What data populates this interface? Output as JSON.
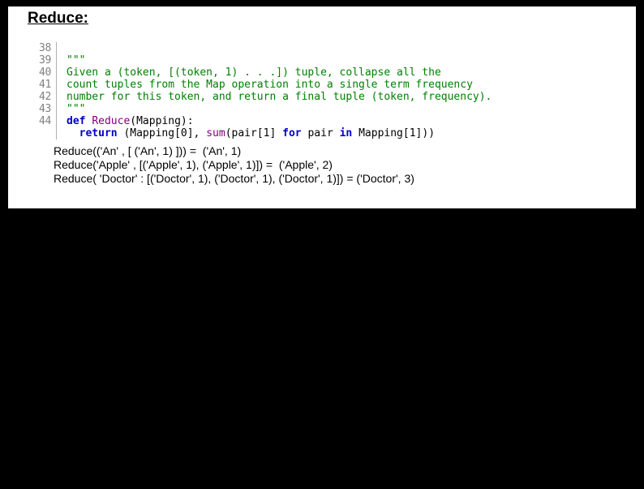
{
  "title": "Reduce:",
  "code": {
    "line_numbers": [
      "38",
      "39",
      "40",
      "41",
      "42",
      "43",
      "44"
    ],
    "l38": "\"\"\"",
    "l39": "Given a (token, [(token, 1) . . .]) tuple, collapse all the",
    "l40": "count tuples from the Map operation into a single term frequency",
    "l41": "number for this token, and return a final tuple (token, frequency).",
    "l42": "\"\"\"",
    "l43": {
      "def": "def ",
      "name": "Reduce",
      "rest": "(Mapping):"
    },
    "l44": {
      "indent": "  ",
      "ret": "return ",
      "p1": "(Mapping[",
      "n0": "0",
      "p2": "], ",
      "sum": "sum",
      "p3": "(pair[",
      "n1": "1",
      "p4": "] ",
      "for": "for",
      "p5": " pair ",
      "in": "in",
      "p6": " Mapping[",
      "n1b": "1",
      "p7": "]))"
    }
  },
  "examples": {
    "e1": "Reduce(('An' , [ ('An', 1) ])) =  ('An', 1)",
    "e2": "Reduce('Apple' , [('Apple', 1), ('Apple', 1)]) =  ('Apple', 2)",
    "e3": "Reduce( 'Doctor' : [('Doctor', 1), ('Doctor', 1), ('Doctor', 1)]) = ('Doctor', 3)"
  }
}
